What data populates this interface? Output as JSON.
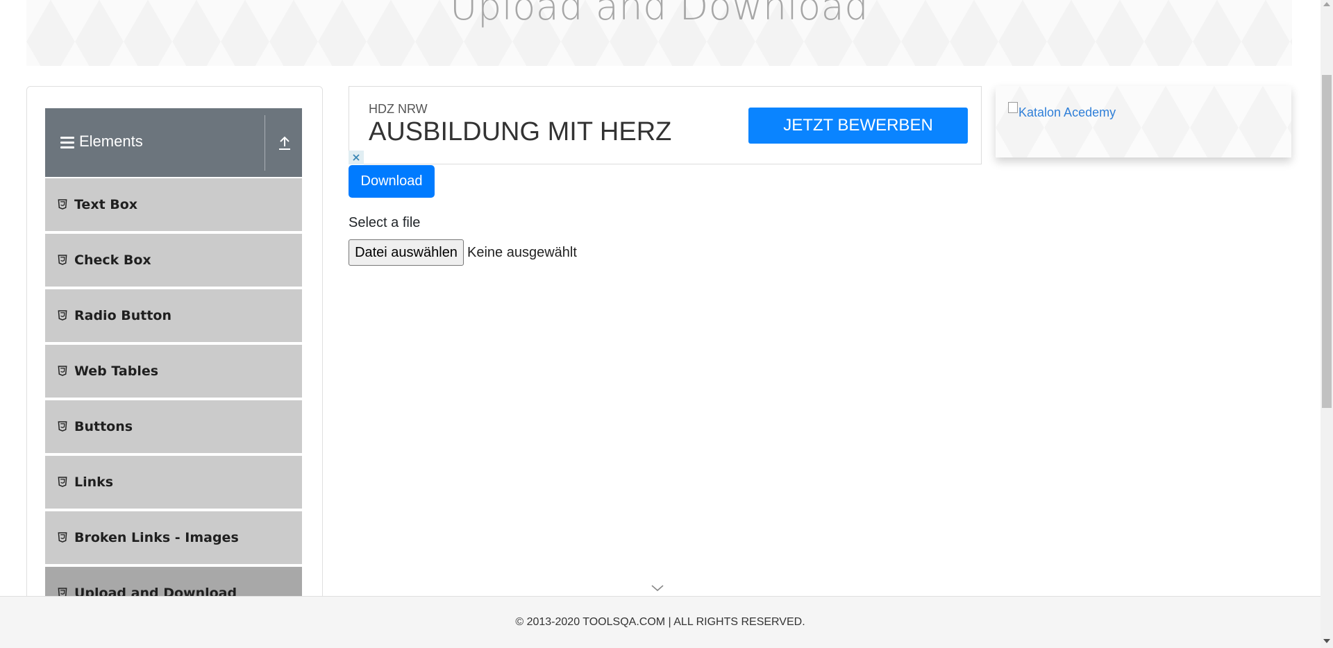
{
  "header": {
    "title": "Upload and Download"
  },
  "sidebar": {
    "group_title": "Elements",
    "items": [
      {
        "label": "Text Box"
      },
      {
        "label": "Check Box"
      },
      {
        "label": "Radio Button"
      },
      {
        "label": "Web Tables"
      },
      {
        "label": "Buttons"
      },
      {
        "label": "Links"
      },
      {
        "label": "Broken Links - Images"
      },
      {
        "label": "Upload and Download",
        "active": true
      }
    ]
  },
  "ad": {
    "brand": "HDZ NRW",
    "headline": "AUSBILDUNG MIT HERZ",
    "cta": "JETZT BEWERBEN"
  },
  "main": {
    "download_label": "Download",
    "select_label": "Select a file",
    "file_button_label": "Datei auswählen",
    "file_status": "Keine ausgewählt"
  },
  "side_ad": {
    "alt_text": "Katalon Acedemy"
  },
  "footer": {
    "text": "© 2013-2020 TOOLSQA.COM | ALL RIGHTS RESERVED."
  },
  "colors": {
    "primary": "#007bff",
    "ad_cta": "#0a84ff",
    "group_header": "#6c757d",
    "menu_item": "#cbcbcb",
    "menu_item_active": "#a8a8a8"
  }
}
